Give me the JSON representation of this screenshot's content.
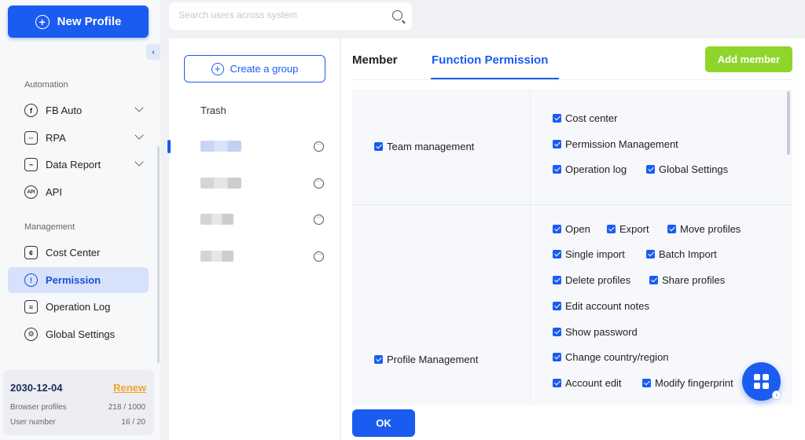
{
  "sidebar": {
    "new_profile_label": "New Profile",
    "collapse_glyph": "‹",
    "section_automation": "Automation",
    "section_management": "Management",
    "automation_items": [
      {
        "label": "FB Auto",
        "icon": "fb-auto-icon"
      },
      {
        "label": "RPA",
        "icon": "rpa-icon"
      },
      {
        "label": "Data Report",
        "icon": "data-report-icon"
      },
      {
        "label": "API",
        "icon": "api-icon"
      }
    ],
    "management_items": [
      {
        "label": "Cost Center",
        "icon": "cost-center-icon"
      },
      {
        "label": "Permission",
        "icon": "permission-shield-icon",
        "active": true
      },
      {
        "label": "Operation Log",
        "icon": "operation-log-icon"
      },
      {
        "label": "Global Settings",
        "icon": "global-settings-icon"
      }
    ],
    "subscription": {
      "expiry_date": "2030-12-04",
      "renew_label": "Renew",
      "browser_profiles_label": "Browser profiles",
      "browser_profiles_value": "218 / 1000",
      "user_number_label": "User number",
      "user_number_value": "16 / 20"
    }
  },
  "search": {
    "placeholder": "Search users across system",
    "value": ""
  },
  "groups": {
    "create_group_label": "Create a group",
    "trash_label": "Trash",
    "more_glyph": "···"
  },
  "main": {
    "tabs": [
      {
        "label": "Member",
        "active": false
      },
      {
        "label": "Function Permission",
        "active": true
      }
    ],
    "add_member_label": "Add member",
    "ok_label": "OK",
    "permissions": {
      "team": {
        "label": "Team management",
        "items": [
          "Cost center",
          "Permission Management",
          "Operation log",
          "Global Settings"
        ]
      },
      "profile": {
        "label": "Profile Management",
        "items": [
          "Open",
          "Export",
          "Move profiles",
          "Single import",
          "Batch Import",
          "Delete profiles",
          "Share profiles",
          "Edit account notes",
          "Show password",
          "Change country/region",
          "Account edit",
          "Modify fingerprint"
        ]
      }
    }
  },
  "colors": {
    "primary": "#1b5cf0",
    "add_member": "#8fd62c",
    "renew": "#f0a52a",
    "active_nav_bg": "#d6e1fb"
  }
}
